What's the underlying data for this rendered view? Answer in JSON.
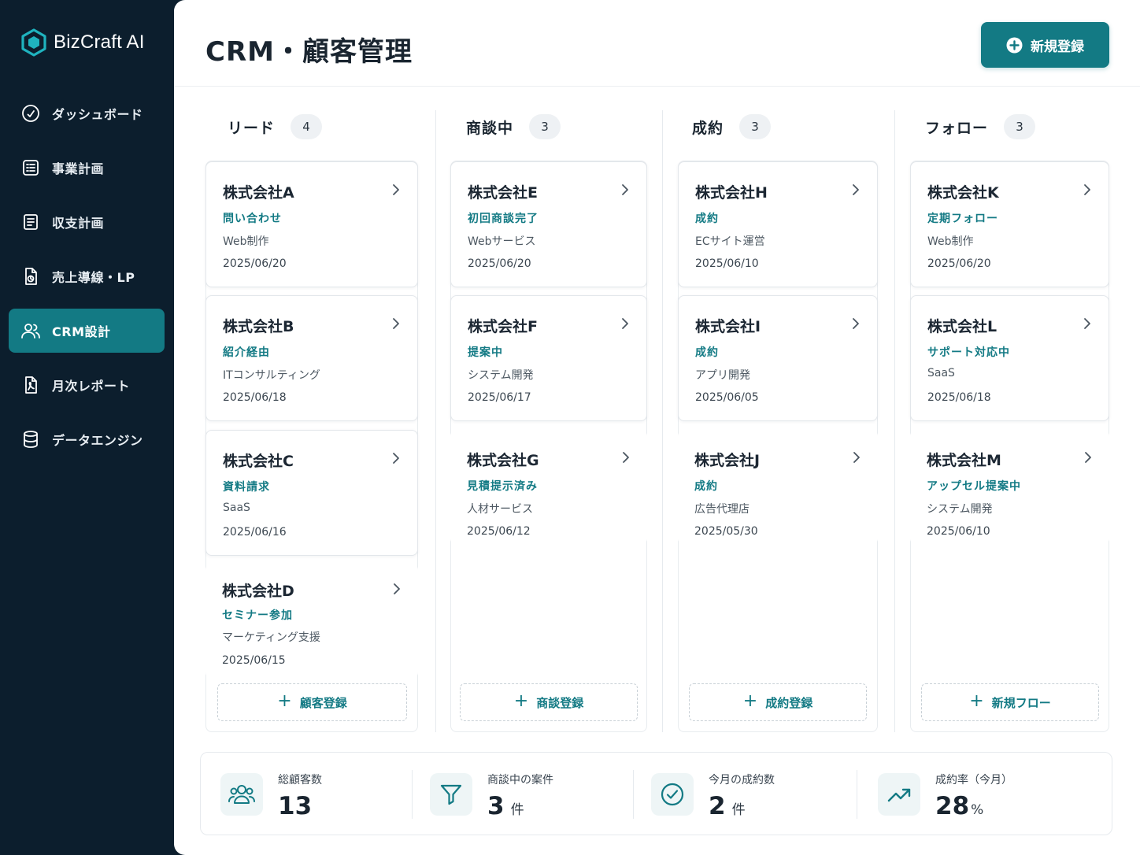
{
  "app": {
    "name": "BizCraft AI"
  },
  "sidebar": {
    "items": [
      {
        "label": "ダッシュボード",
        "icon": "dashboard-gauge-icon",
        "active": false
      },
      {
        "label": "事業計画",
        "icon": "checklist-icon",
        "active": false
      },
      {
        "label": "収支計画",
        "icon": "document-icon",
        "active": false
      },
      {
        "label": "売上導線・LP",
        "icon": "file-chart-icon",
        "active": false
      },
      {
        "label": "CRM設計",
        "icon": "users-icon",
        "active": true
      },
      {
        "label": "月次レポート",
        "icon": "pdf-report-icon",
        "active": false
      },
      {
        "label": "データエンジン",
        "icon": "database-icon",
        "active": false
      }
    ]
  },
  "header": {
    "title": "CRM・顧客管理",
    "new_button_label": "新規登録"
  },
  "columns": [
    {
      "title": "リード",
      "count": "4",
      "add_label": "顧客登録",
      "cards": [
        {
          "name": "株式会社A",
          "status": "問い合わせ",
          "industry": "Web制作",
          "date": "2025/06/20"
        },
        {
          "name": "株式会社B",
          "status": "紹介経由",
          "industry": "ITコンサルティング",
          "date": "2025/06/18"
        },
        {
          "name": "株式会社C",
          "status": "資料請求",
          "industry": "SaaS",
          "date": "2025/06/16"
        },
        {
          "name": "株式会社D",
          "status": "セミナー参加",
          "industry": "マーケティング支援",
          "date": "2025/06/15"
        }
      ]
    },
    {
      "title": "商談中",
      "count": "3",
      "add_label": "商談登録",
      "cards": [
        {
          "name": "株式会社E",
          "status": "初回商談完了",
          "industry": "Webサービス",
          "date": "2025/06/20"
        },
        {
          "name": "株式会社F",
          "status": "提案中",
          "industry": "システム開発",
          "date": "2025/06/17"
        },
        {
          "name": "株式会社G",
          "status": "見積提示済み",
          "industry": "人材サービス",
          "date": "2025/06/12"
        }
      ]
    },
    {
      "title": "成約",
      "count": "3",
      "add_label": "成約登録",
      "cards": [
        {
          "name": "株式会社H",
          "status": "成約",
          "industry": "ECサイト運営",
          "date": "2025/06/10"
        },
        {
          "name": "株式会社I",
          "status": "成約",
          "industry": "アプリ開発",
          "date": "2025/06/05"
        },
        {
          "name": "株式会社J",
          "status": "成約",
          "industry": "広告代理店",
          "date": "2025/05/30"
        }
      ]
    },
    {
      "title": "フォロー",
      "count": "3",
      "add_label": "新規フロー",
      "cards": [
        {
          "name": "株式会社K",
          "status": "定期フォロー",
          "industry": "Web制作",
          "date": "2025/06/20"
        },
        {
          "name": "株式会社L",
          "status": "サポート対応中",
          "industry": "SaaS",
          "date": "2025/06/18"
        },
        {
          "name": "株式会社M",
          "status": "アップセル提案中",
          "industry": "システム開発",
          "date": "2025/06/10"
        }
      ]
    }
  ],
  "stats": [
    {
      "label": "総顧客数",
      "value": "13",
      "unit": "",
      "icon": "users-icon"
    },
    {
      "label": "商談中の案件",
      "value": "3",
      "unit": "件",
      "icon": "funnel-icon"
    },
    {
      "label": "今月の成約数",
      "value": "2",
      "unit": "件",
      "icon": "check-circle-icon"
    },
    {
      "label": "成約率（今月）",
      "value": "28",
      "unit": "%",
      "icon": "trend-up-icon"
    }
  ],
  "colors": {
    "accent": "#137a84",
    "sidebar_bg": "#0c1e2d"
  }
}
